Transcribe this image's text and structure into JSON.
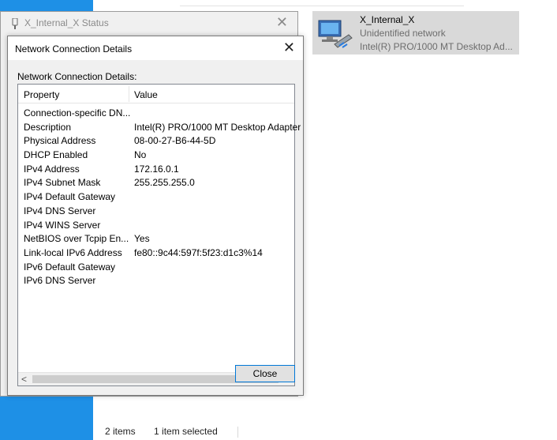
{
  "explorer": {
    "status_items": "2 items",
    "status_selected": "1 item selected"
  },
  "network_tile": {
    "name": "X_Internal_X",
    "status": "Unidentified network",
    "adapter": "Intel(R) PRO/1000 MT Desktop Ad..."
  },
  "status_window": {
    "title": "X_Internal_X Status"
  },
  "dialog": {
    "title": "Network Connection Details",
    "label": "Network Connection Details:",
    "columns": [
      "Property",
      "Value"
    ],
    "rows": [
      {
        "property": "Connection-specific DN...",
        "value": ""
      },
      {
        "property": "Description",
        "value": "Intel(R) PRO/1000 MT Desktop Adapter"
      },
      {
        "property": "Physical Address",
        "value": "08-00-27-B6-44-5D"
      },
      {
        "property": "DHCP Enabled",
        "value": "No"
      },
      {
        "property": "IPv4 Address",
        "value": "172.16.0.1"
      },
      {
        "property": "IPv4 Subnet Mask",
        "value": "255.255.255.0"
      },
      {
        "property": "IPv4 Default Gateway",
        "value": ""
      },
      {
        "property": "IPv4 DNS Server",
        "value": ""
      },
      {
        "property": "IPv4 WINS Server",
        "value": ""
      },
      {
        "property": "NetBIOS over Tcpip En...",
        "value": "Yes"
      },
      {
        "property": "Link-local IPv6 Address",
        "value": "fe80::9c44:597f:5f23:d1c3%14"
      },
      {
        "property": "IPv6 Default Gateway",
        "value": ""
      },
      {
        "property": "IPv6 DNS Server",
        "value": ""
      }
    ],
    "close_label": "Close"
  },
  "icons": {
    "close": "close-icon",
    "network": "network-adapter-icon",
    "scroll_left": "scroll-left-icon",
    "scroll_right": "scroll-right-icon"
  },
  "colors": {
    "desktop": "#1e90e6",
    "selection": "#d9d9d9",
    "button_border": "#0078d7"
  }
}
